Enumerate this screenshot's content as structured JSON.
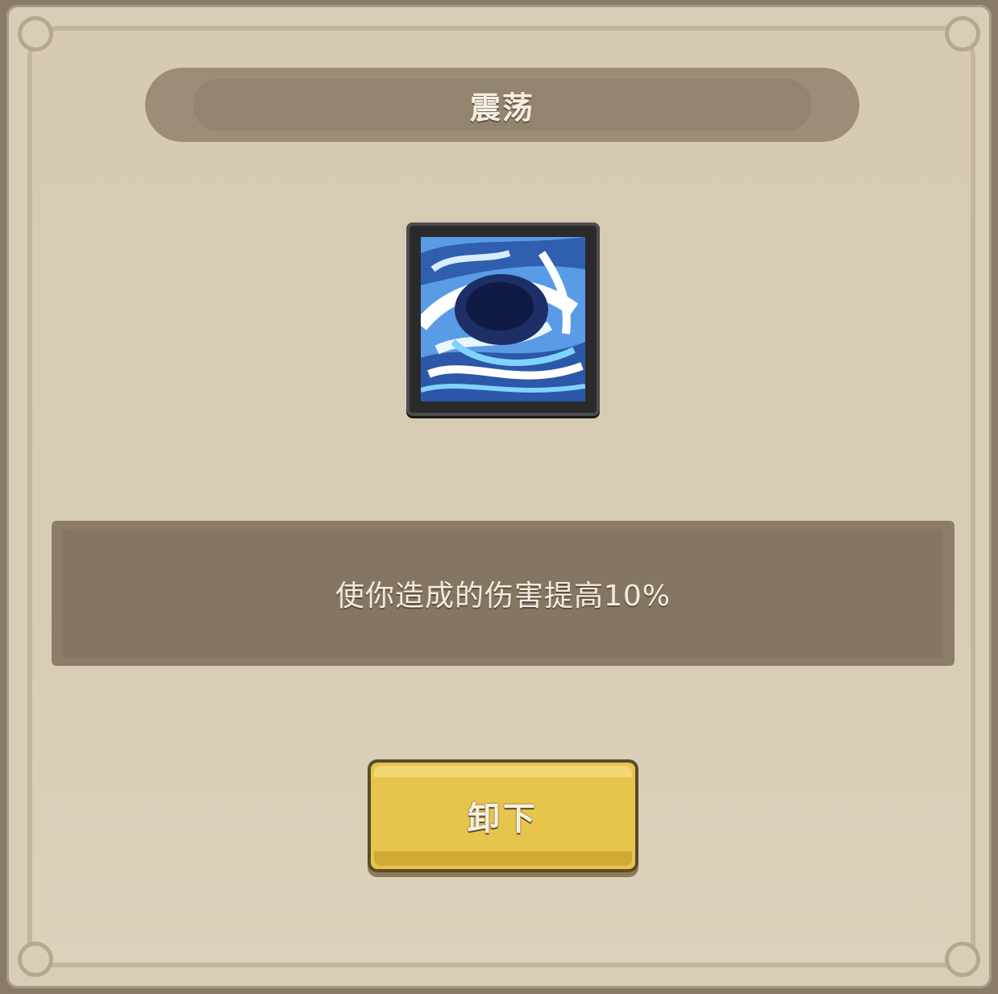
{
  "dialog": {
    "title": "震荡",
    "skill_icon": "shockwave-vortex-icon",
    "description": "使你造成的伤害提高10%",
    "unequip_label": "卸下"
  },
  "colors": {
    "panel": "#d8cdb6",
    "banner": "#9c8d79",
    "description_box": "#8c7c69",
    "button": "#e7c54d",
    "icon_blue": "#4a86d8"
  }
}
